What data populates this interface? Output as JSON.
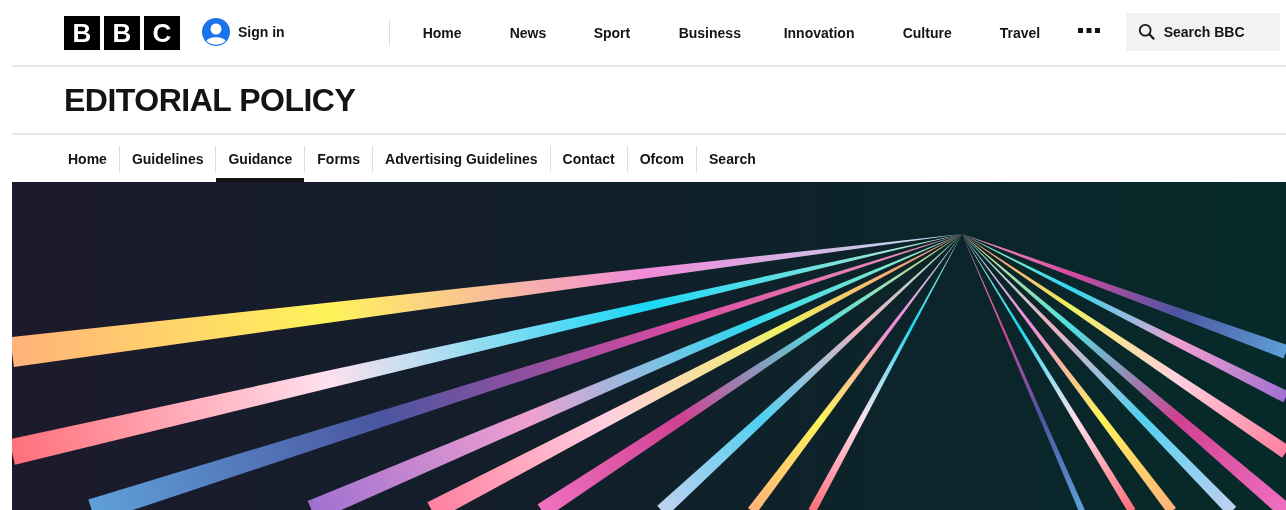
{
  "header": {
    "logo": [
      "B",
      "B",
      "C"
    ],
    "sign_in": "Sign in",
    "nav": [
      {
        "label": "Home"
      },
      {
        "label": "News"
      },
      {
        "label": "Sport"
      },
      {
        "label": "Business"
      },
      {
        "label": "Innovation"
      },
      {
        "label": "Culture"
      },
      {
        "label": "Travel"
      }
    ],
    "search": {
      "label": "Search BBC"
    }
  },
  "title": "EDITORIAL POLICY",
  "subnav": [
    {
      "label": "Home",
      "selected": false
    },
    {
      "label": "Guidelines",
      "selected": false
    },
    {
      "label": "Guidance",
      "selected": true
    },
    {
      "label": "Forms",
      "selected": false
    },
    {
      "label": "Advertising Guidelines",
      "selected": false
    },
    {
      "label": "Contact",
      "selected": false
    },
    {
      "label": "Ofcom",
      "selected": false
    },
    {
      "label": "Search",
      "selected": false
    }
  ]
}
